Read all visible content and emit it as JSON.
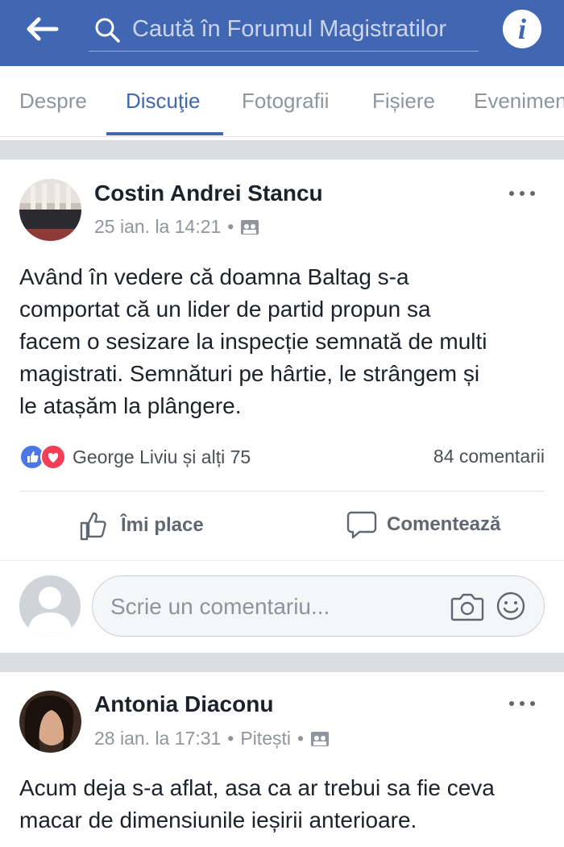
{
  "header": {
    "search_placeholder": "Caută în Forumul Magistratilor",
    "back_icon": "arrow-left-icon",
    "info_icon": "info-icon",
    "bg_color": "#4267b2"
  },
  "tabs": [
    {
      "label": "Despre",
      "active": false
    },
    {
      "label": "Discuţie",
      "active": true
    },
    {
      "label": "Fotografii",
      "active": false
    },
    {
      "label": "Fișiere",
      "active": false
    },
    {
      "label": "Evenimente",
      "active": false
    }
  ],
  "posts": [
    {
      "author": "Costin Andrei Stancu",
      "time": "25 ian. la 14:21",
      "text_lines": [
        "Având în vedere că doamna Baltag s-a",
        "comportat că un lider de partid propun sa",
        "facem o sesizare la inspecție semnată de multi",
        "magistrati. Semnături pe hârtie, le strângem și",
        "le atașăm la plângere."
      ],
      "reactions": "George Liviu și alți 75",
      "comments": "84 comentarii"
    },
    {
      "author": "Antonia Diaconu",
      "time": "28 ian. la 17:31",
      "location": "Pitești",
      "text_lines": [
        "Acum deja s-a aflat, asa ca ar trebui sa fie ceva",
        "macar de dimensiunile ieșirii anterioare."
      ]
    }
  ],
  "actions": {
    "like": "Îmi place",
    "comment": "Comentează"
  },
  "comment_box": {
    "placeholder": "Scrie un comentariu..."
  }
}
